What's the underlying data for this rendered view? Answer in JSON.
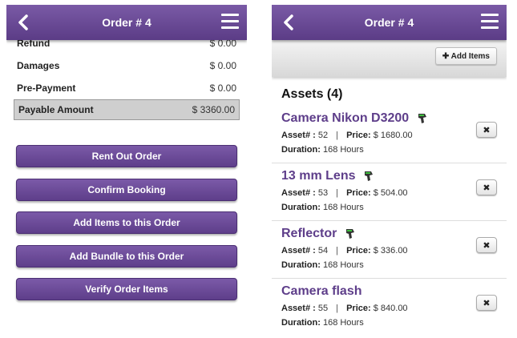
{
  "left": {
    "header": {
      "title": "Order # 4"
    },
    "summary": [
      {
        "label": "Refund",
        "value": "$ 0.00"
      },
      {
        "label": "Damages",
        "value": "$ 0.00"
      },
      {
        "label": "Pre-Payment",
        "value": "$ 0.00"
      }
    ],
    "payable": {
      "label": "Payable Amount",
      "value": "$ 3360.00"
    },
    "buttons": [
      "Rent Out Order",
      "Confirm Booking",
      "Add Items to this Order",
      "Add Bundle to this Order",
      "Verify Order Items"
    ]
  },
  "right": {
    "header": {
      "title": "Order # 4"
    },
    "add_items_label": "Add Items",
    "assets_heading": "Assets (4)",
    "asset_label": "Asset# :",
    "price_label": "Price:",
    "duration_label": "Duration:",
    "assets": [
      {
        "name": "Camera Nikon D3200",
        "asset_no": "52",
        "price": "$ 1680.00",
        "duration": "168 Hours",
        "has_tag_icon": true
      },
      {
        "name": "13 mm Lens",
        "asset_no": "53",
        "price": "$ 504.00",
        "duration": "168 Hours",
        "has_tag_icon": true
      },
      {
        "name": "Reflector",
        "asset_no": "54",
        "price": "$ 336.00",
        "duration": "168 Hours",
        "has_tag_icon": true
      },
      {
        "name": "Camera flash",
        "asset_no": "55",
        "price": "$ 840.00",
        "duration": "168 Hours",
        "has_tag_icon": false
      }
    ],
    "remove_symbol": "✖"
  },
  "colors": {
    "primary": "#5e3e8a",
    "appbar_light": "#7a5aa6",
    "payable_bg": "#cfcfcf"
  },
  "icons": {
    "back": "chevron-left-icon",
    "menu": "hamburger-menu-icon",
    "tag": "barcode-scanner-icon",
    "remove": "close-icon"
  }
}
